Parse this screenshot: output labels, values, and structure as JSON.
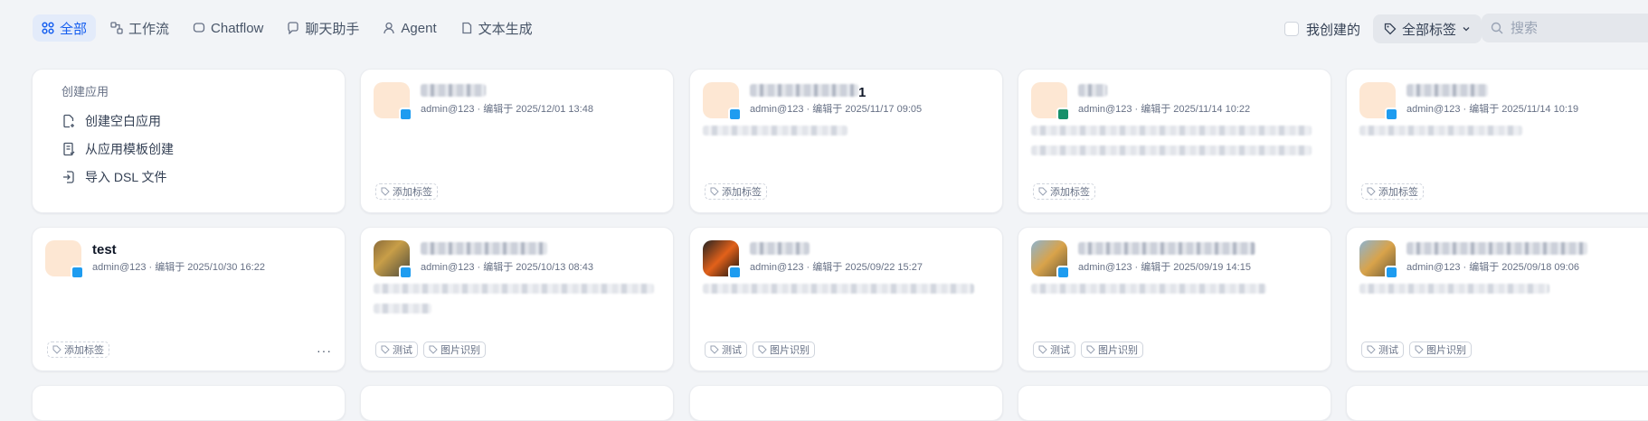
{
  "tabs": [
    {
      "label": "全部",
      "icon": "grid-icon",
      "active": true
    },
    {
      "label": "工作流",
      "icon": "workflow-icon"
    },
    {
      "label": "Chatflow",
      "icon": "chatflow-icon"
    },
    {
      "label": "聊天助手",
      "icon": "chat-icon"
    },
    {
      "label": "Agent",
      "icon": "agent-icon"
    },
    {
      "label": "文本生成",
      "icon": "document-icon"
    }
  ],
  "filters": {
    "mine_label": "我创建的",
    "tags_label": "全部标签",
    "search_placeholder": "搜索"
  },
  "create": {
    "title": "创建应用",
    "items": [
      {
        "label": "创建空白应用"
      },
      {
        "label": "从应用模板创建"
      },
      {
        "label": "导入 DSL 文件"
      }
    ]
  },
  "add_tag_label": "添加标签",
  "apps": [
    {
      "name": "",
      "meta": "admin@123 · 编辑于 2025/12/01 13:48",
      "tags": []
    },
    {
      "name": "1",
      "meta": "admin@123 · 编辑于 2025/11/17 09:05",
      "tags": []
    },
    {
      "name": "",
      "meta": "admin@123 · 编辑于 2025/11/14 10:22",
      "tags": []
    },
    {
      "name": "",
      "meta": "admin@123 · 编辑于 2025/11/14 10:19",
      "tags": []
    },
    {
      "name": "test",
      "meta": "admin@123 · 编辑于 2025/10/30 16:22",
      "tags": [],
      "more": "···"
    },
    {
      "name": "",
      "meta": "admin@123 · 编辑于 2025/10/13 08:43",
      "tags": [
        "测试",
        "图片识别"
      ]
    },
    {
      "name": "",
      "meta": "admin@123 · 编辑于 2025/09/22 15:27",
      "tags": [
        "测试",
        "图片识别"
      ]
    },
    {
      "name": "",
      "meta": "admin@123 · 编辑于 2025/09/19 14:15",
      "tags": [
        "测试",
        "图片识别"
      ]
    },
    {
      "name": "",
      "meta": "admin@123 · 编辑于 2025/09/18 09:06",
      "tags": [
        "测试",
        "图片识别"
      ]
    }
  ]
}
